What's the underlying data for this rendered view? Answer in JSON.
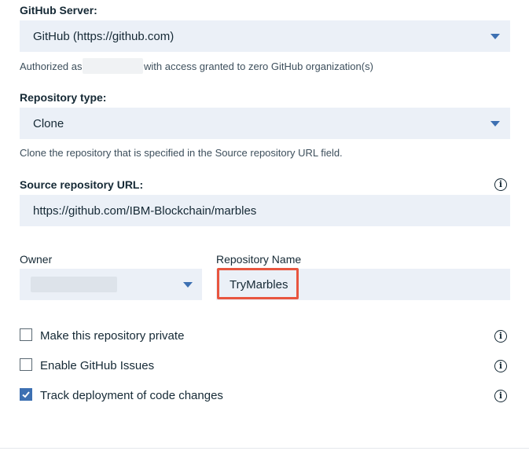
{
  "github_server": {
    "label": "GitHub Server:",
    "selected": "GitHub (https://github.com)",
    "auth_prefix": "Authorized as",
    "auth_suffix": "with access granted to zero GitHub organization(s)"
  },
  "repository_type": {
    "label": "Repository type:",
    "selected": "Clone",
    "helper": "Clone the repository that is specified in the Source repository URL field."
  },
  "source_url": {
    "label": "Source repository URL:",
    "value": "https://github.com/IBM-Blockchain/marbles"
  },
  "owner": {
    "label": "Owner"
  },
  "repo_name": {
    "label": "Repository Name",
    "value": "TryMarbles"
  },
  "options": [
    {
      "label": "Make this repository private",
      "checked": false
    },
    {
      "label": "Enable GitHub Issues",
      "checked": false
    },
    {
      "label": "Track deployment of code changes",
      "checked": true
    }
  ],
  "colors": {
    "field_bg": "#ebf0f7",
    "accent": "#3d70b2",
    "highlight": "#e8553f"
  }
}
